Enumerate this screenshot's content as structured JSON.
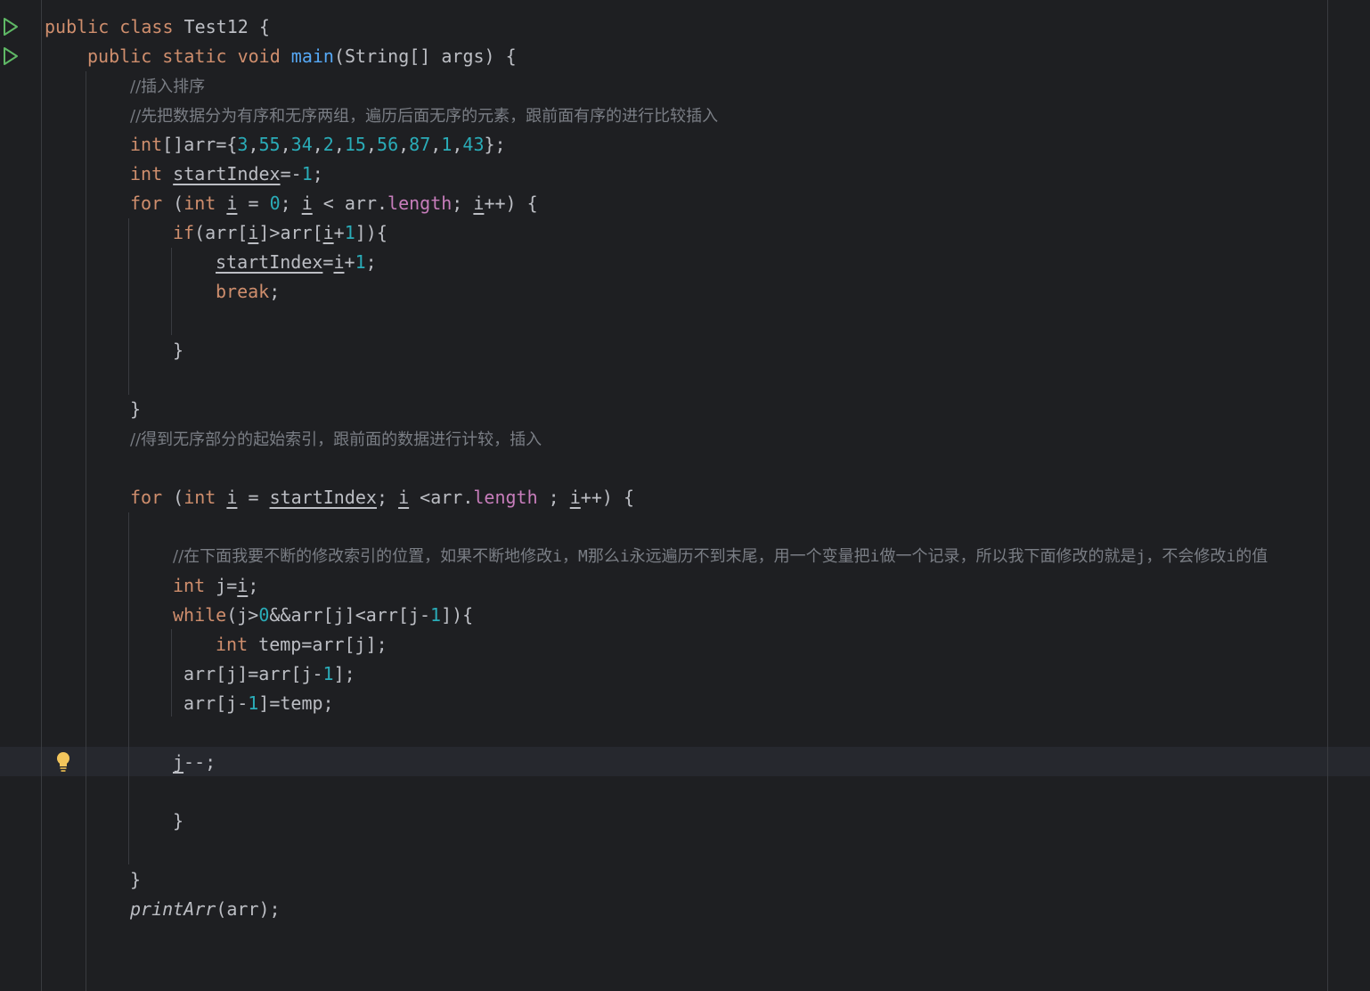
{
  "editor": {
    "language": "java",
    "lines": {
      "l1_a": "public class ",
      "l1_b": "Test12 {",
      "l2_a": "public static void ",
      "l2_b": "main",
      "l2_c": "(String[] args) {",
      "l3": "//插入排序",
      "l4": "//先把数据分为有序和无序两组，遍历后面无序的元素，跟前面有序的进行比较插入",
      "l5_kw": "int",
      "l5_a": "[]arr={",
      "l5_n1": "3",
      "l5_n2": "55",
      "l5_n3": "34",
      "l5_n4": "2",
      "l5_n5": "15",
      "l5_n6": "56",
      "l5_n7": "87",
      "l5_n8": "1",
      "l5_n9": "43",
      "l5_end": "};",
      "l6_kw": "int ",
      "l6_var": "startIndex",
      "l6_a": "=-",
      "l6_n": "1",
      "l6_end": ";",
      "l7_for": "for ",
      "l7_a": "(",
      "l7_int": "int ",
      "l7_i": "i",
      "l7_b": " = ",
      "l7_zero": "0",
      "l7_c": "; ",
      "l7_i2": "i",
      "l7_d": " < arr.",
      "l7_len": "length",
      "l7_e": "; ",
      "l7_i3": "i",
      "l7_f": "++) {",
      "l8_if": "if",
      "l8_a": "(arr[",
      "l8_i": "i",
      "l8_b": "]>arr[",
      "l8_i2": "i",
      "l8_c": "+",
      "l8_n": "1",
      "l8_d": "]){",
      "l9_var": "startIndex",
      "l9_a": "=",
      "l9_i": "i",
      "l9_b": "+",
      "l9_n": "1",
      "l9_c": ";",
      "l10": "break",
      "l10_end": ";",
      "l12": "}",
      "l14": "}",
      "l15": "//得到无序部分的起始索引，跟前面的数据进行计较，插入",
      "l17_for": "for ",
      "l17_a": "(",
      "l17_int": "int ",
      "l17_i": "i",
      "l17_b": " = ",
      "l17_si": "startIndex",
      "l17_c": "; ",
      "l17_i2": "i",
      "l17_d": " <arr.",
      "l17_len": "length",
      "l17_e": " ; ",
      "l17_i3": "i",
      "l17_f": "++) {",
      "l19_a": "//在下面我要不断的修改索引的位置，如果不断地修改",
      "l19_i1": "i",
      "l19_b": "，",
      "l19_m": "M",
      "l19_c": "那么",
      "l19_i2": "i",
      "l19_d": "永远遍历不到末尾，用一个变量把",
      "l19_i3": "i",
      "l19_e": "做一个记录，所以我下面修改的就是",
      "l19_j": "j",
      "l19_f": "，不会修改",
      "l19_i4": "i",
      "l19_g": "的值",
      "l20_kw": "int ",
      "l20_a": "j=",
      "l20_i": "i",
      "l20_b": ";",
      "l21_kw": "while",
      "l21_a": "(j>",
      "l21_n": "0",
      "l21_b": "&&arr[j]<arr[j-",
      "l21_n2": "1",
      "l21_c": "]){",
      "l22_kw": "int ",
      "l22_a": "temp=arr[j];",
      "l23_a": "arr[j]=arr[j-",
      "l23_n": "1",
      "l23_b": "];",
      "l24_a": "arr[j-",
      "l24_n": "1",
      "l24_b": "]=temp;",
      "l26_j": "j",
      "l26_a": "--;",
      "l28": "}",
      "l30": "}",
      "l31_fn": "printArr",
      "l31_a": "(arr);"
    }
  },
  "colors": {
    "background": "#1e1f22",
    "keyword": "#cf8e6d",
    "method": "#56a8f5",
    "number": "#2aacb8",
    "field": "#c77dbb",
    "comment": "#7a7e85",
    "text": "#bcbec4",
    "run_icon": "#5fb865",
    "bulb": "#f2c55c"
  },
  "icons": {
    "run_class": "run-gutter-icon",
    "run_main": "run-gutter-icon",
    "intention": "lightbulb-icon"
  }
}
